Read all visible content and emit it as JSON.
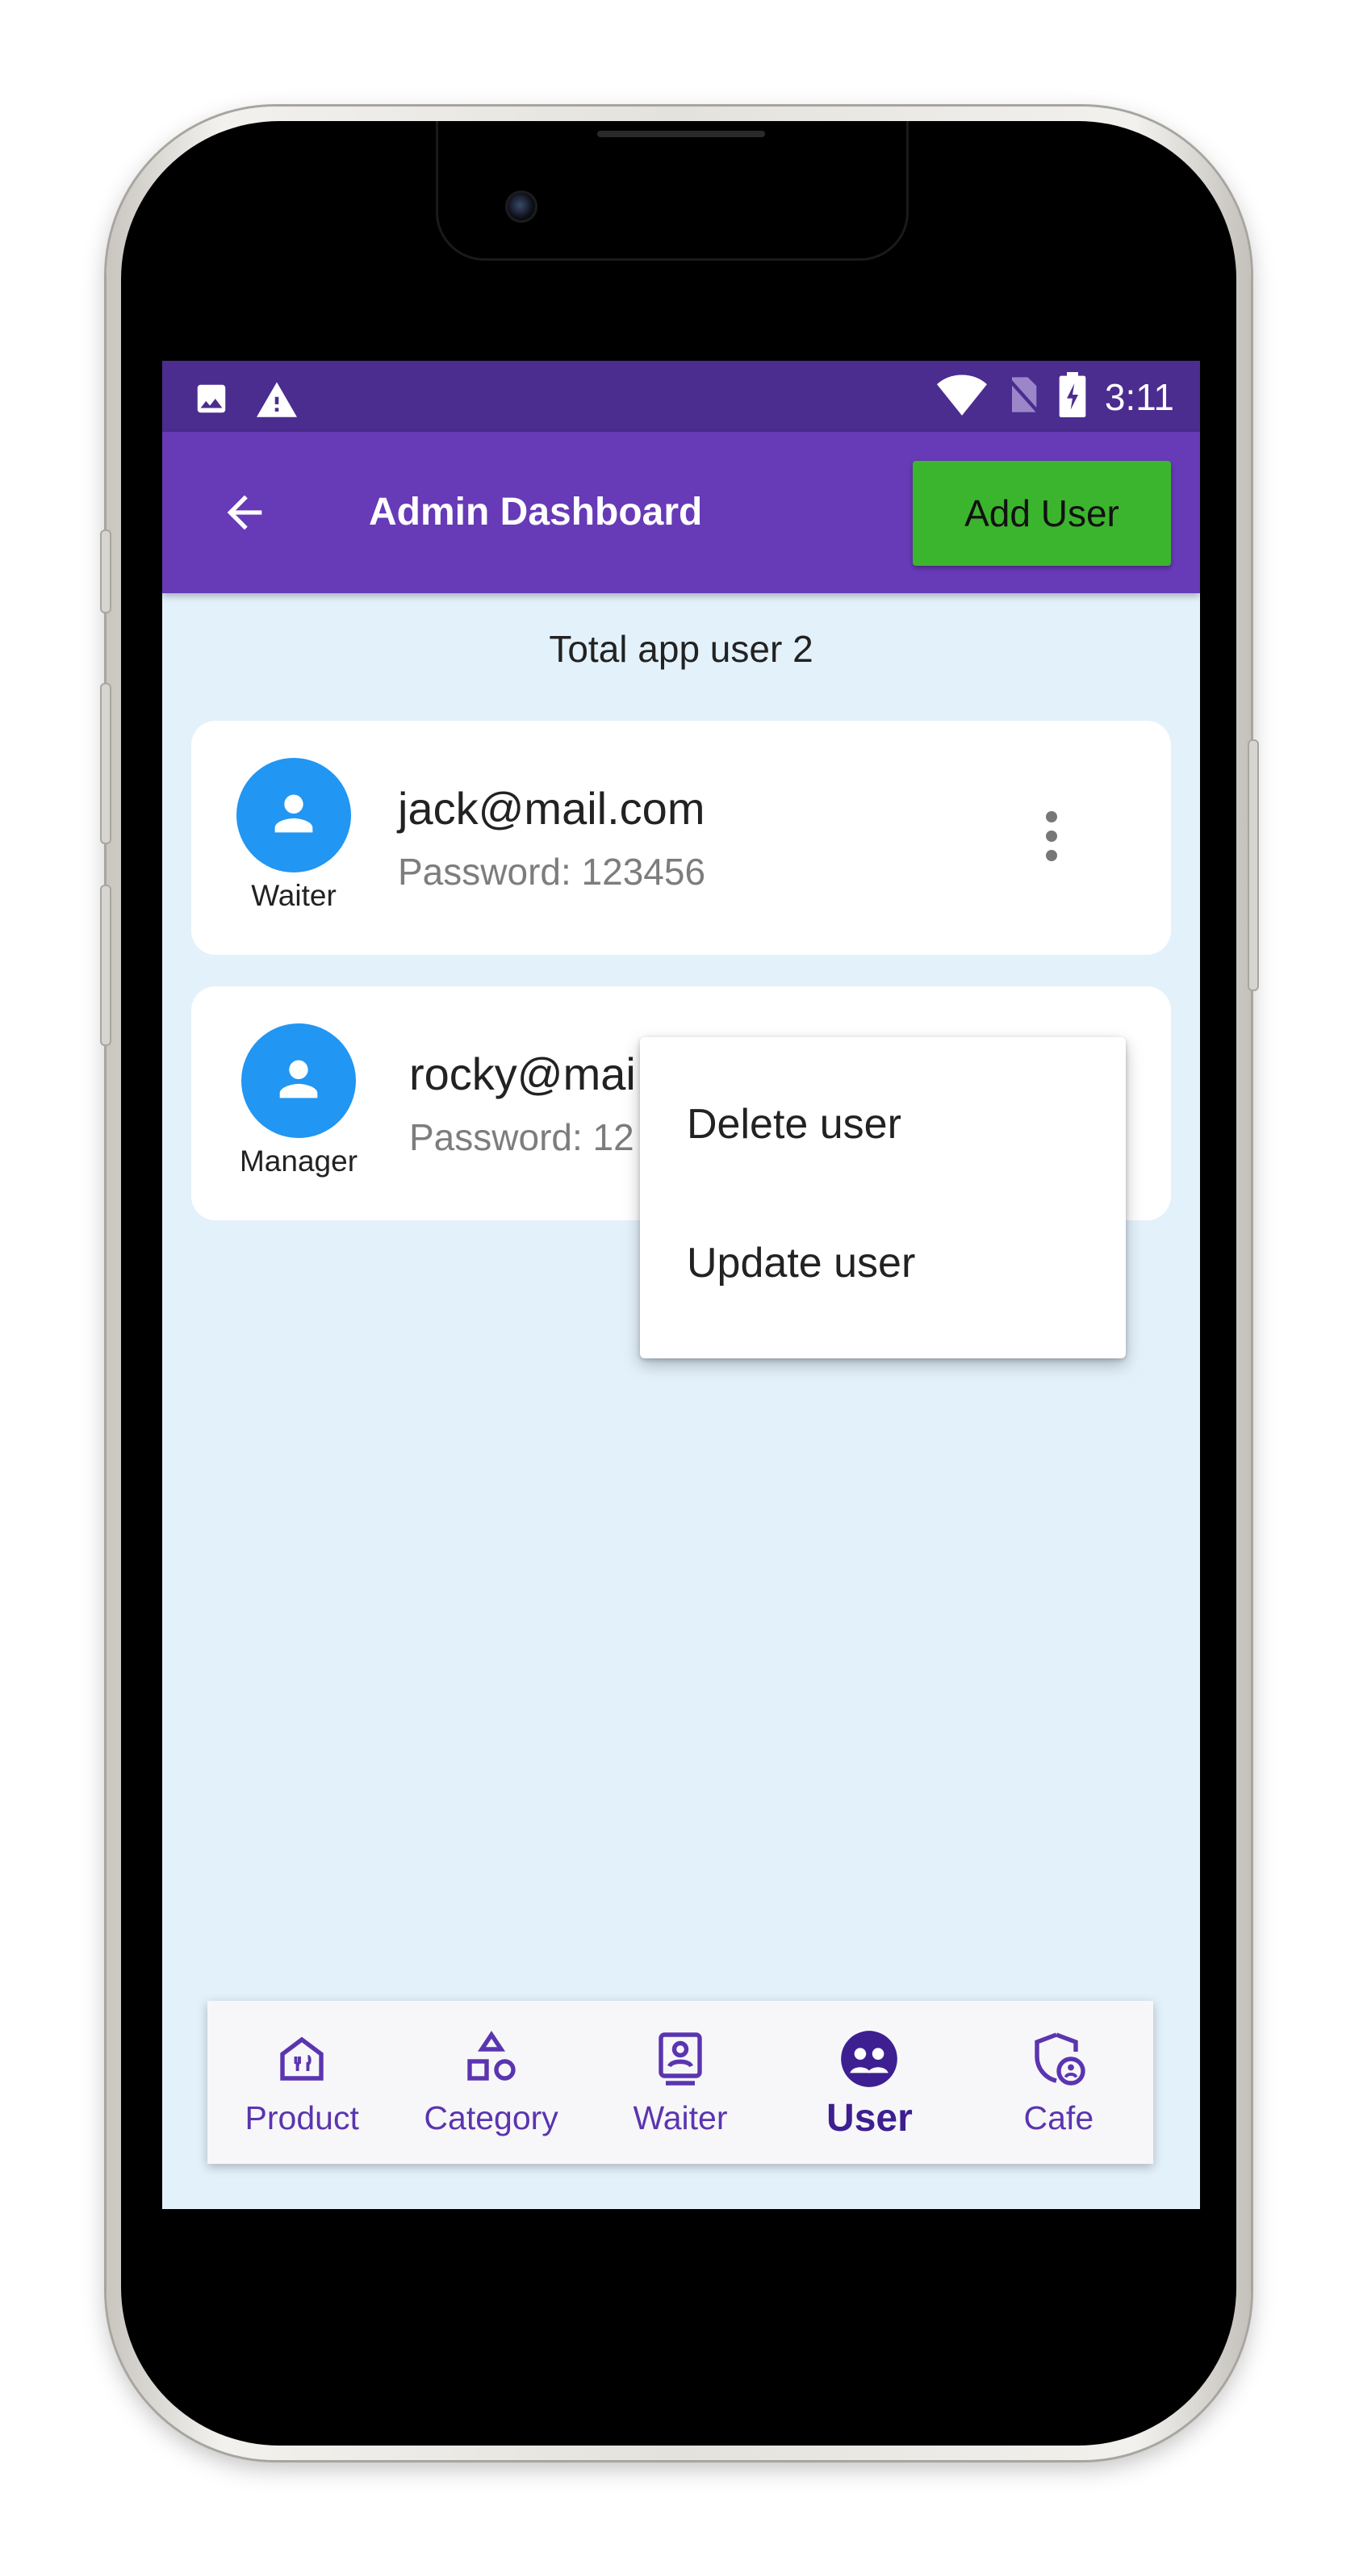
{
  "status_bar": {
    "time": "3:11",
    "left_icons": [
      "image-icon",
      "warning-icon"
    ],
    "right_icons": [
      "wifi-icon",
      "no-sim-icon",
      "battery-charging-icon"
    ]
  },
  "app_bar": {
    "back_icon": "arrow-back-icon",
    "title": "Admin Dashboard",
    "add_user_label": "Add User"
  },
  "summary": {
    "total_label": "Total app user 2"
  },
  "users": [
    {
      "email": "jack@mail.com",
      "password": "Password: 123456",
      "role": "Waiter",
      "avatar_icon": "person-icon",
      "menu_icon": "more-vert-icon"
    },
    {
      "email": "rocky@mai",
      "password": "Password: 12",
      "role": "Manager",
      "avatar_icon": "person-icon"
    }
  ],
  "popup_menu": {
    "items": [
      "Delete user",
      "Update user"
    ]
  },
  "bottom_nav": {
    "items": [
      {
        "label": "Product",
        "icon": "product-house-icon",
        "active": false
      },
      {
        "label": "Category",
        "icon": "category-shapes-icon",
        "active": false
      },
      {
        "label": "Waiter",
        "icon": "waiter-badge-icon",
        "active": false
      },
      {
        "label": "User",
        "icon": "user-group-icon",
        "active": true
      },
      {
        "label": "Cafe",
        "icon": "cafe-shield-icon",
        "active": false
      }
    ]
  },
  "colors": {
    "status_bar": "#4b2c8f",
    "app_bar": "#673ab7",
    "add_user_button": "#3cb52e",
    "avatar": "#2196f3",
    "background": "#e3f1fb",
    "nav_active": "#3d1f91"
  }
}
